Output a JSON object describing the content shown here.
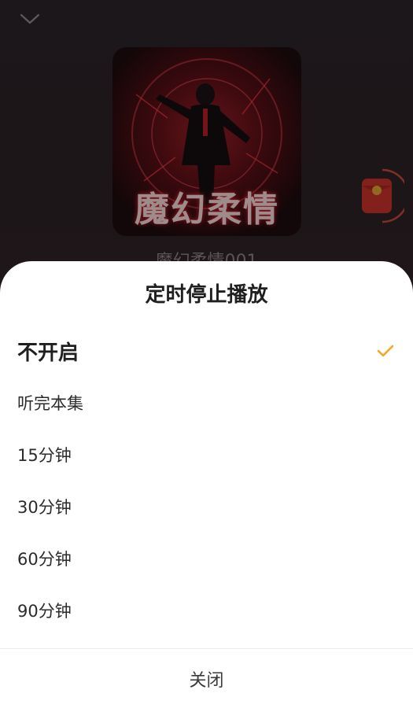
{
  "player": {
    "cover_text": "魔幻柔情",
    "track_title": "魔幻柔情001"
  },
  "sheet": {
    "title": "定时停止播放",
    "options": [
      {
        "label": "不开启",
        "selected": true
      },
      {
        "label": "听完本集",
        "selected": false
      },
      {
        "label": "15分钟",
        "selected": false
      },
      {
        "label": "30分钟",
        "selected": false
      },
      {
        "label": "60分钟",
        "selected": false
      },
      {
        "label": "90分钟",
        "selected": false
      }
    ],
    "close_label": "关闭"
  },
  "colors": {
    "accent": "#f5a623",
    "sheet_bg": "#ffffff"
  },
  "icons": {
    "collapse": "chevron-down-icon",
    "check": "checkmark-icon",
    "reward": "red-packet-icon"
  }
}
